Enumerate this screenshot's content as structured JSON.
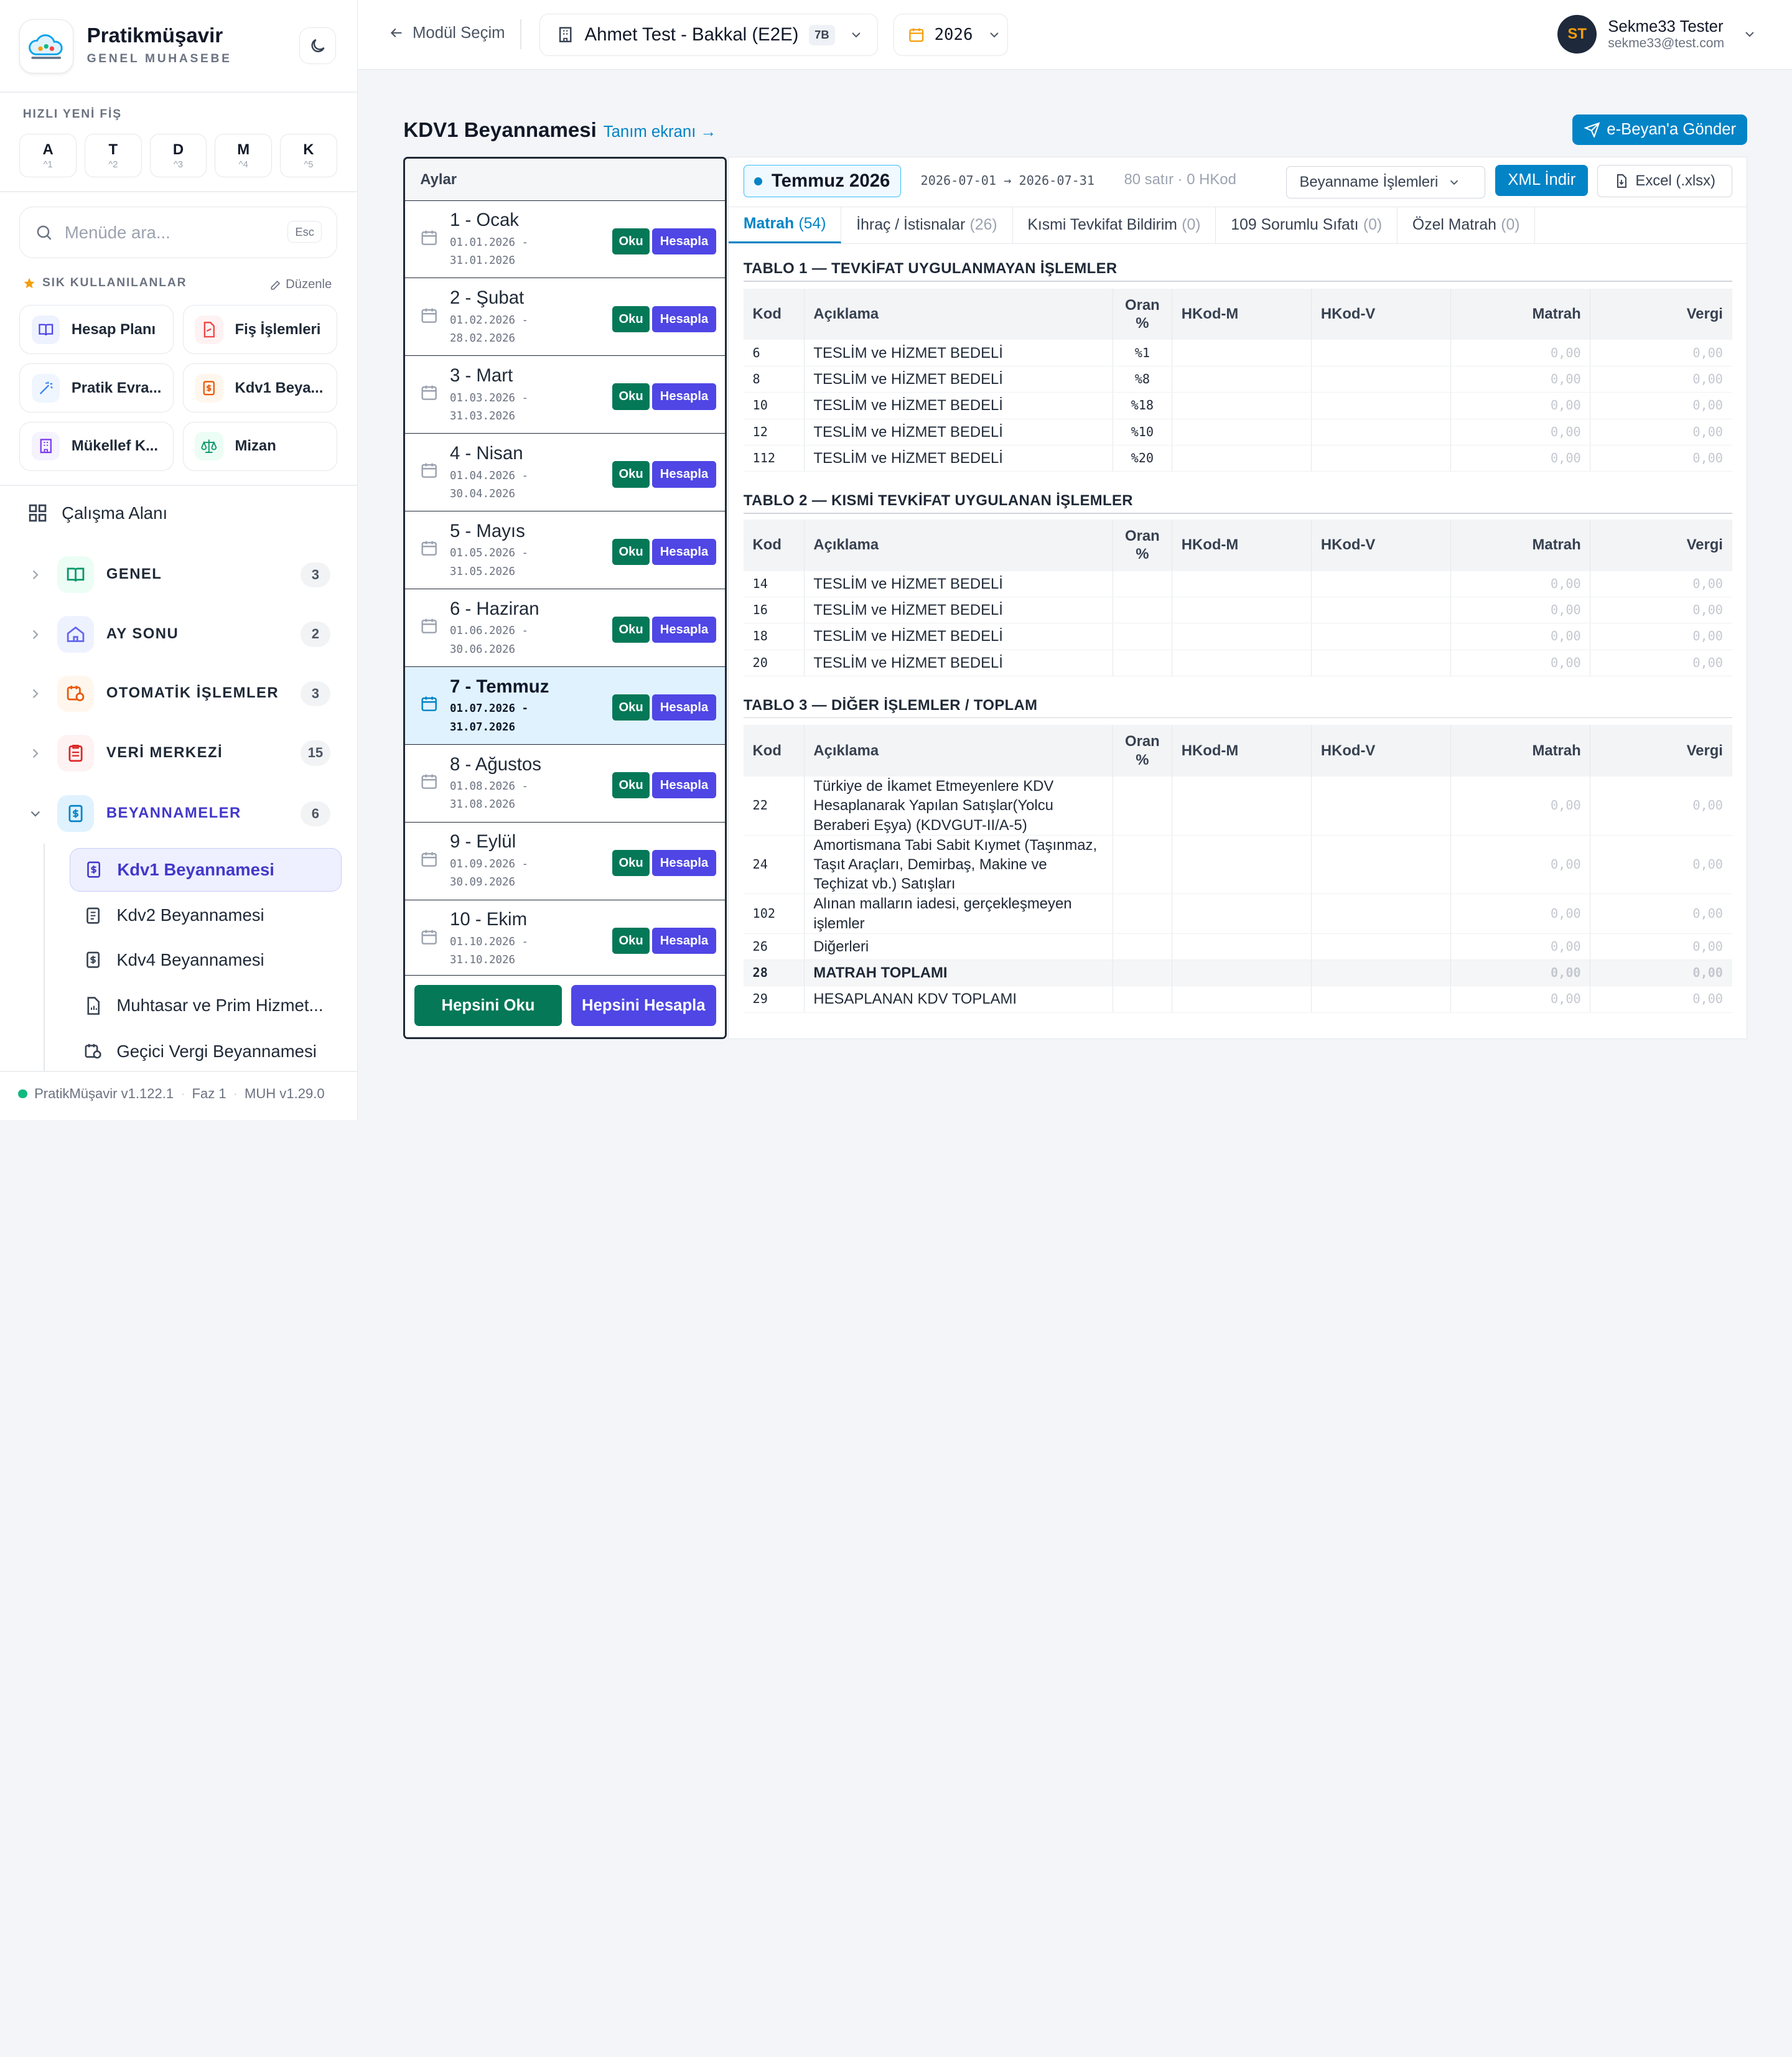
{
  "brand": {
    "name": "Pratikmüşavir",
    "subtitle": "GENEL MUHASEBE"
  },
  "quick": {
    "title": "HIZLI YENİ FİŞ",
    "keys": [
      {
        "k": "A",
        "s": "^1"
      },
      {
        "k": "T",
        "s": "^2"
      },
      {
        "k": "D",
        "s": "^3"
      },
      {
        "k": "M",
        "s": "^4"
      },
      {
        "k": "K",
        "s": "^5"
      }
    ]
  },
  "search": {
    "placeholder": "Menüde ara...",
    "esc": "Esc"
  },
  "favorites": {
    "title": "SIK KULLANILANLAR",
    "edit": "Düzenle",
    "items": [
      "Hesap Planı",
      "Fiş İşlemleri",
      "Pratik Evra...",
      "Kdv1 Beya...",
      "Mükellef K...",
      "Mizan"
    ]
  },
  "workspace": "Çalışma Alanı",
  "groups": [
    {
      "label": "GENEL",
      "count": "3"
    },
    {
      "label": "AY SONU",
      "count": "2"
    },
    {
      "label": "OTOMATİK İŞLEMLER",
      "count": "3"
    },
    {
      "label": "VERİ MERKEZİ",
      "count": "15"
    },
    {
      "label": "BEYANNAMELER",
      "count": "6"
    }
  ],
  "subitems": [
    "Kdv1 Beyannamesi",
    "Kdv2 Beyannamesi",
    "Kdv4 Beyannamesi",
    "Muhtasar ve Prim Hizmet...",
    "Geçici Vergi Beyannamesi"
  ],
  "footer": {
    "version": "PratikMüşavir v1.122.1",
    "phase": "Faz 1",
    "muh": "MUH v1.29.0"
  },
  "topbar": {
    "back": "Modül Seçim",
    "company": "Ahmet Test - Bakkal (E2E)",
    "company_badge": "7B",
    "year": "2026",
    "user_initials": "ST",
    "user_name": "Sekme33 Tester",
    "user_email": "sekme33@test.com"
  },
  "page": {
    "title": "KDV1 Beyannamesi",
    "link": "Tanım ekranı →",
    "send": "e-Beyan'a Gönder"
  },
  "months": {
    "header": "Aylar",
    "read": "Oku",
    "calc": "Hesapla",
    "read_all": "Hepsini Oku",
    "calc_all": "Hepsini Hesapla",
    "items": [
      {
        "name": "1 - Ocak",
        "from": "01.01.2026 -",
        "to": "31.01.2026"
      },
      {
        "name": "2 - Şubat",
        "from": "01.02.2026 -",
        "to": "28.02.2026"
      },
      {
        "name": "3 - Mart",
        "from": "01.03.2026 -",
        "to": "31.03.2026"
      },
      {
        "name": "4 - Nisan",
        "from": "01.04.2026 -",
        "to": "30.04.2026"
      },
      {
        "name": "5 - Mayıs",
        "from": "01.05.2026 -",
        "to": "31.05.2026"
      },
      {
        "name": "6 - Haziran",
        "from": "01.06.2026 -",
        "to": "30.06.2026"
      },
      {
        "name": "7 - Temmuz",
        "from": "01.07.2026 -",
        "to": "31.07.2026"
      },
      {
        "name": "8 - Ağustos",
        "from": "01.08.2026 -",
        "to": "31.08.2026"
      },
      {
        "name": "9 - Eylül",
        "from": "01.09.2026 -",
        "to": "30.09.2026"
      },
      {
        "name": "10 - Ekim",
        "from": "01.10.2026 -",
        "to": "31.10.2026"
      }
    ]
  },
  "period": {
    "label": "Temmuz 2026",
    "range": "2026-07-01 → 2026-07-31",
    "count": "80 satır · 0 HKod",
    "ops": "Beyanname İşlemleri",
    "xml": "XML İndir",
    "excel": "Excel (.xlsx)"
  },
  "tabs": [
    {
      "label": "Matrah",
      "n": "(54)"
    },
    {
      "label": "İhraç / İstisnalar",
      "n": "(26)"
    },
    {
      "label": "Kısmi Tevkifat Bildirim",
      "n": "(0)"
    },
    {
      "label": "109 Sorumlu Sıfatı",
      "n": "(0)"
    },
    {
      "label": "Özel Matrah",
      "n": "(0)"
    }
  ],
  "columns": {
    "kod": "Kod",
    "aciklama": "Açıklama",
    "oran": "Oran %",
    "hkodm": "HKod-M",
    "hkodv": "HKod-V",
    "matrah": "Matrah",
    "vergi": "Vergi"
  },
  "table1": {
    "title": "TABLO 1 — TEVKİFAT UYGULANMAYAN İŞLEMLER",
    "rows": [
      {
        "kod": "6",
        "aciklama": "TESLİM ve HİZMET BEDELİ",
        "oran": "%1",
        "matrah": "0,00",
        "vergi": "0,00"
      },
      {
        "kod": "8",
        "aciklama": "TESLİM ve HİZMET BEDELİ",
        "oran": "%8",
        "matrah": "0,00",
        "vergi": "0,00"
      },
      {
        "kod": "10",
        "aciklama": "TESLİM ve HİZMET BEDELİ",
        "oran": "%18",
        "matrah": "0,00",
        "vergi": "0,00"
      },
      {
        "kod": "12",
        "aciklama": "TESLİM ve HİZMET BEDELİ",
        "oran": "%10",
        "matrah": "0,00",
        "vergi": "0,00"
      },
      {
        "kod": "112",
        "aciklama": "TESLİM ve HİZMET BEDELİ",
        "oran": "%20",
        "matrah": "0,00",
        "vergi": "0,00"
      }
    ]
  },
  "table2": {
    "title": "TABLO 2 — KISMİ TEVKİFAT UYGULANAN İŞLEMLER",
    "rows": [
      {
        "kod": "14",
        "aciklama": "TESLİM ve HİZMET BEDELİ",
        "oran": "",
        "matrah": "0,00",
        "vergi": "0,00"
      },
      {
        "kod": "16",
        "aciklama": "TESLİM ve HİZMET BEDELİ",
        "oran": "",
        "matrah": "0,00",
        "vergi": "0,00"
      },
      {
        "kod": "18",
        "aciklama": "TESLİM ve HİZMET BEDELİ",
        "oran": "",
        "matrah": "0,00",
        "vergi": "0,00"
      },
      {
        "kod": "20",
        "aciklama": "TESLİM ve HİZMET BEDELİ",
        "oran": "",
        "matrah": "0,00",
        "vergi": "0,00"
      }
    ]
  },
  "table3": {
    "title": "TABLO 3 — DİĞER İŞLEMLER / TOPLAM",
    "rows": [
      {
        "kod": "22",
        "aciklama": "Türkiye de İkamet Etmeyenlere KDV Hesaplanarak Yapılan Satışlar(Yolcu Beraberi Eşya) (KDVGUT-II/A-5)",
        "oran": "",
        "matrah": "0,00",
        "vergi": "0,00"
      },
      {
        "kod": "24",
        "aciklama": "Amortismana Tabi Sabit Kıymet (Taşınmaz, Taşıt Araçları, Demirbaş, Makine ve Teçhizat vb.) Satışları",
        "oran": "",
        "matrah": "0,00",
        "vergi": "0,00"
      },
      {
        "kod": "102",
        "aciklama": "Alınan malların iadesi, gerçekleşmeyen işlemler",
        "oran": "",
        "matrah": "0,00",
        "vergi": "0,00"
      },
      {
        "kod": "26",
        "aciklama": "Diğerleri",
        "oran": "",
        "matrah": "0,00",
        "vergi": "0,00"
      },
      {
        "kod": "28",
        "aciklama": "MATRAH TOPLAMI",
        "oran": "",
        "matrah": "0,00",
        "vergi": "0,00",
        "bold": true
      },
      {
        "kod": "29",
        "aciklama": "HESAPLANAN KDV TOPLAMI",
        "oran": "",
        "matrah": "0,00",
        "vergi": "0,00"
      }
    ]
  }
}
